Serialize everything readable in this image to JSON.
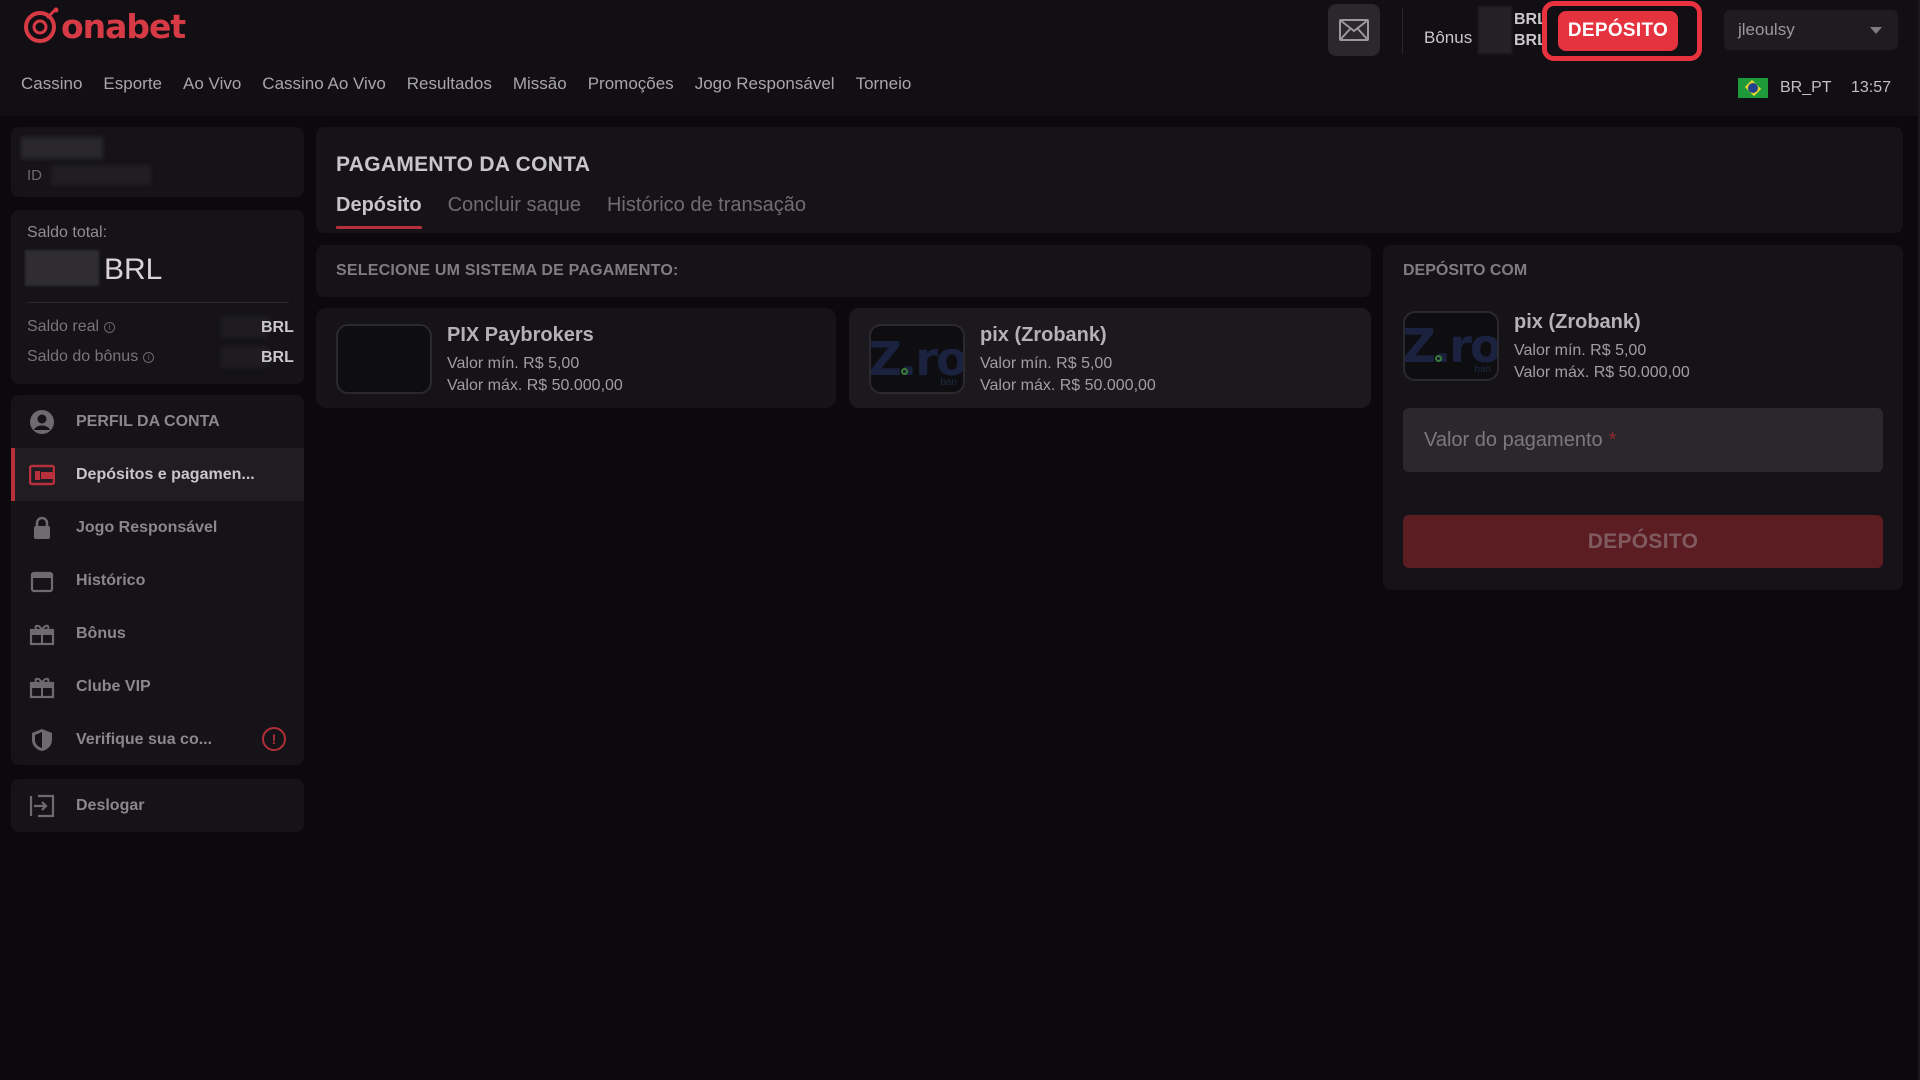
{
  "brand": {
    "name": "onabet",
    "color": "#d63a45"
  },
  "header": {
    "mail_icon": "envelope-icon",
    "bonus_label": "Bônus",
    "currency_top": "BRL",
    "currency_bottom": "BRL",
    "deposit_button": "DEPÓSITO",
    "username": "jleoulsy",
    "accent": "#e5323f"
  },
  "nav": [
    "Cassino",
    "Esporte",
    "Ao Vivo",
    "Cassino Ao Vivo",
    "Resultados",
    "Missão",
    "Promoções",
    "Jogo Responsável",
    "Torneio"
  ],
  "locale": {
    "flag": "brazil-flag",
    "code": "BR_PT",
    "time": "13:57"
  },
  "sidebar": {
    "id_label": "ID",
    "balance": {
      "title": "Saldo total:",
      "currency": "BRL",
      "real_label": "Saldo real",
      "real_currency": "BRL",
      "bonus_label": "Saldo do bônus",
      "bonus_currency": "BRL"
    },
    "menu": [
      {
        "label": "PERFIL DA CONTA",
        "icon": "user-circle-icon"
      },
      {
        "label": "Depósitos e pagamen...",
        "icon": "wallet-icon",
        "active": true
      },
      {
        "label": "Jogo Responsável",
        "icon": "lock-icon"
      },
      {
        "label": "Histórico",
        "icon": "calendar-icon"
      },
      {
        "label": "Bônus",
        "icon": "gift-icon"
      },
      {
        "label": "Clube VIP",
        "icon": "gift-icon"
      },
      {
        "label": "Verifique sua co...",
        "icon": "shield-icon",
        "alert": "!"
      }
    ],
    "logout": {
      "label": "Deslogar",
      "icon": "logout-icon"
    }
  },
  "main": {
    "title": "PAGAMENTO DA CONTA",
    "tabs": [
      "Depósito",
      "Concluir saque",
      "Histórico de transação"
    ],
    "select_title": "SELECIONE UM SISTEMA DE PAGAMENTO:",
    "methods": [
      {
        "name": "PIX Paybrokers",
        "min": "Valor mín. R$ 5,00",
        "max": "Valor máx. R$ 50.000,00"
      },
      {
        "name": "pix (Zrobank)",
        "min": "Valor mín. R$ 5,00",
        "max": "Valor máx. R$ 50.000,00",
        "logo_text": "Z.ro",
        "logo_sub": "ban"
      }
    ]
  },
  "deposit_panel": {
    "title": "DEPÓSITO COM",
    "method_name": "pix (Zrobank)",
    "min": "Valor mín. R$ 5,00",
    "max": "Valor máx. R$ 50.000,00",
    "amount_placeholder": "Valor do pagamento",
    "required_mark": "*",
    "submit": "DEPÓSITO"
  }
}
